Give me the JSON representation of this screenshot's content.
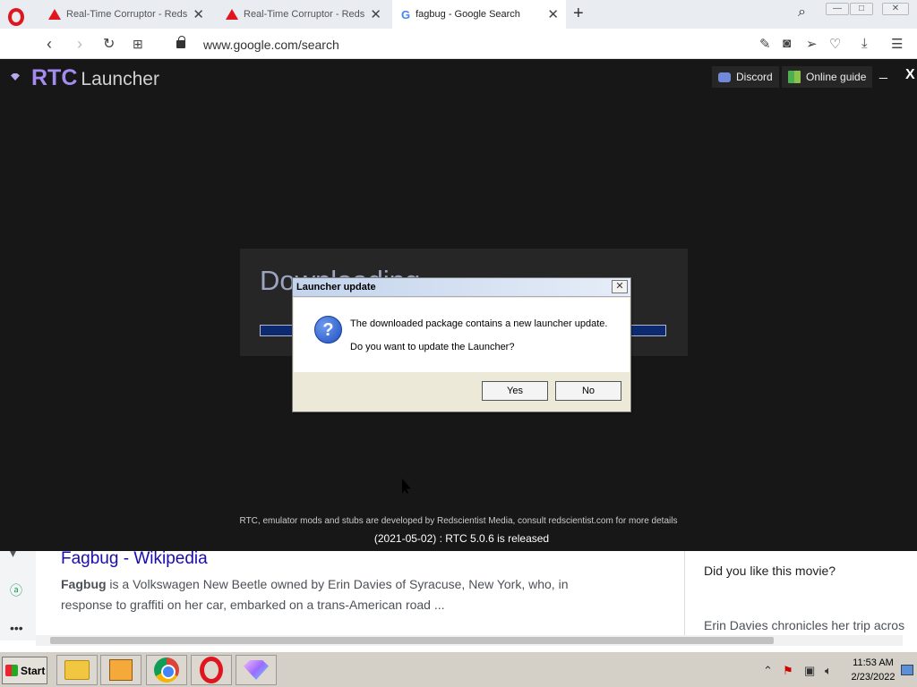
{
  "browser": {
    "tabs": [
      {
        "title": "Real-Time Corruptor - Redsci",
        "icon": "warning-icon"
      },
      {
        "title": "Real-Time Corruptor - Redsci",
        "icon": "warning-icon"
      },
      {
        "title": "fagbug - Google Search",
        "icon": "google-icon",
        "active": true
      }
    ],
    "url": "www.google.com/search"
  },
  "google_page": {
    "result_title": "Fagbug - Wikipedia",
    "result_snippet_bold": "Fagbug",
    "result_snippet_rest": " is a Volkswagen New Beetle owned by Erin Davies of Syracuse, New York, who, in response to graffiti on her car, embarked on a trans-American road ...",
    "kp_question": "Did you like this movie?",
    "kp_text": "Erin Davies chronicles her trip acros"
  },
  "launcher": {
    "title_bold": "RTC",
    "title_rest": "Launcher",
    "discord_label": "Discord",
    "guide_label": "Online guide",
    "minimize_label": "_",
    "close_label": "X",
    "download_text": "Downloading",
    "footer_text": "RTC, emulator mods and stubs are developed by Redscientist Media, consult redscientist.com for more details",
    "release_text": "(2021-05-02) : RTC 5.0.6 is released"
  },
  "dialog": {
    "title": "Launcher update",
    "line1": "The downloaded package contains a new launcher update.",
    "line2": "Do you want to update the Launcher?",
    "yes_label": "Yes",
    "no_label": "No"
  },
  "taskbar": {
    "start_label": "Start",
    "apps": [
      "file-explorer-icon",
      "media-player-icon",
      "chrome-icon",
      "opera-icon",
      "rtc-gem-icon"
    ],
    "time": "11:53 AM",
    "date": "2/23/2022"
  }
}
